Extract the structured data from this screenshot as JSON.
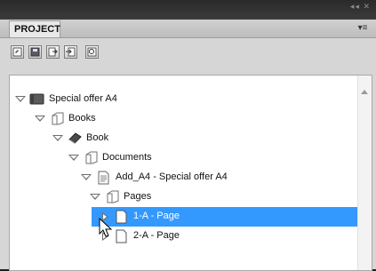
{
  "panel": {
    "tab_label": "PROJECT",
    "menu_icon": "panel-menu-icon"
  },
  "toolbar": {
    "buttons": [
      {
        "name": "open-project-button",
        "icon": "open-icon"
      },
      {
        "name": "save-project-button",
        "icon": "save-icon"
      },
      {
        "name": "export-button",
        "icon": "export-icon"
      },
      {
        "name": "import-button",
        "icon": "import-icon"
      },
      {
        "name": "preview-button",
        "icon": "preview-icon"
      }
    ]
  },
  "tree": {
    "items": [
      {
        "label": "Special offer A4",
        "icon": "document-book-icon",
        "level": 0,
        "state": "expanded",
        "selected": false
      },
      {
        "label": "Books",
        "icon": "folder-icon",
        "level": 1,
        "state": "expanded",
        "selected": false
      },
      {
        "label": "Book",
        "icon": "book-icon",
        "level": 2,
        "state": "expanded",
        "selected": false
      },
      {
        "label": "Documents",
        "icon": "folder-icon",
        "level": 3,
        "state": "expanded",
        "selected": false
      },
      {
        "label": "Add_A4 - Special offer A4",
        "icon": "file-icon",
        "level": 4,
        "state": "expanded",
        "selected": false
      },
      {
        "label": "Pages",
        "icon": "folder-icon",
        "level": 5,
        "state": "expanded",
        "selected": false
      },
      {
        "label": "1-A - Page",
        "icon": "page-icon",
        "level": 6,
        "state": "collapsed",
        "selected": true
      },
      {
        "label": "2-A - Page",
        "icon": "page-icon",
        "level": 6,
        "state": "collapsed",
        "selected": false
      }
    ]
  },
  "colors": {
    "selection": "#3399ff",
    "panel_bg": "#d6d6d6"
  }
}
